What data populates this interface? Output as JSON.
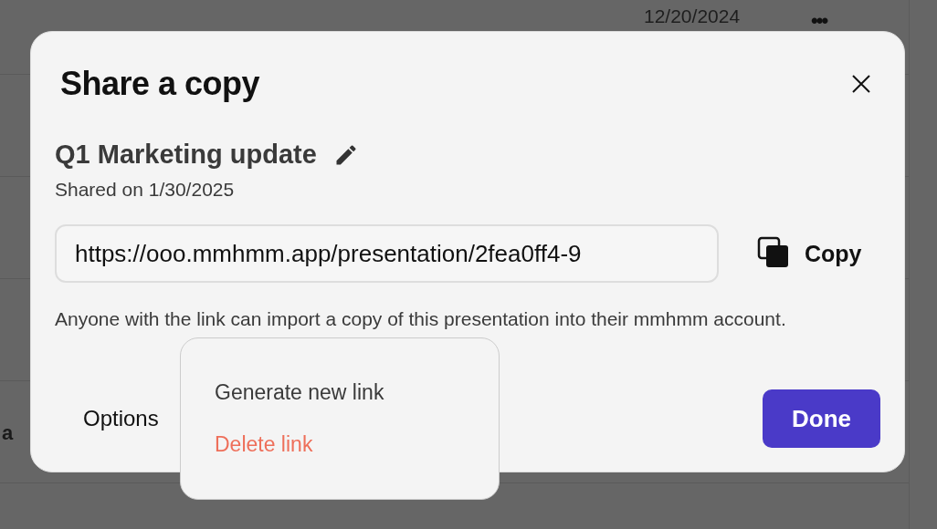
{
  "background": {
    "date": "12/20/2024",
    "more_glyph": "•••",
    "partial_title": "a"
  },
  "dialog": {
    "title": "Share a copy",
    "document_name": "Q1 Marketing update",
    "shared_on": "Shared on 1/30/2025",
    "link": "https://ooo.mmhmm.app/presentation/2fea0ff4-9",
    "copy_label": "Copy",
    "note": "Anyone with the link can import a copy of this presentation into their mmhmm account.",
    "options_label": "Options",
    "done_label": "Done"
  },
  "options_menu": [
    {
      "label": "Generate new link",
      "kind": "normal"
    },
    {
      "label": "Delete link",
      "kind": "destructive"
    }
  ]
}
